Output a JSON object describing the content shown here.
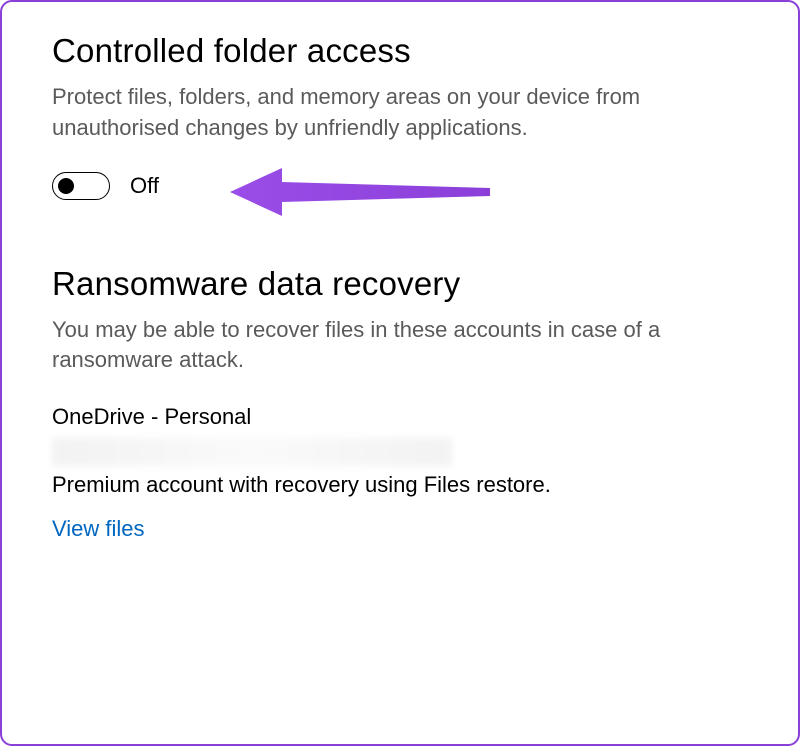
{
  "controlledFolderAccess": {
    "heading": "Controlled folder access",
    "description": "Protect files, folders, and memory areas on your device from unauthorised changes by unfriendly applications.",
    "toggle": {
      "state": "off",
      "label": "Off"
    }
  },
  "ransomwareRecovery": {
    "heading": "Ransomware data recovery",
    "description": "You may be able to recover files in these accounts in case of a ransomware attack.",
    "account": {
      "name": "OneDrive - Personal",
      "description": "Premium account with recovery using Files restore.",
      "viewFilesLink": "View files"
    }
  },
  "colors": {
    "frameBorder": "#8b3fd9",
    "arrowFill": "#8b3fd9",
    "linkColor": "#0067c0",
    "textGray": "#5a5a5a"
  }
}
